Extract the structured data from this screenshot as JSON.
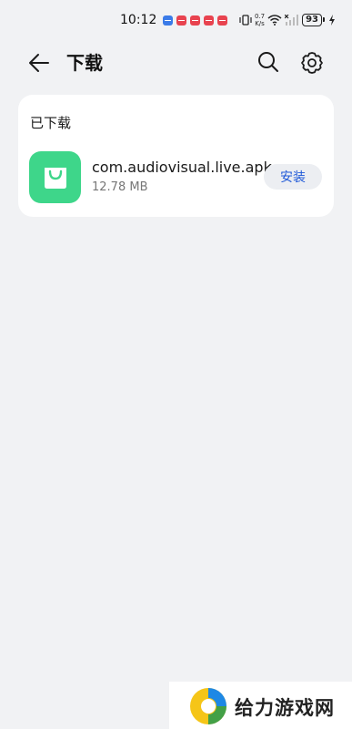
{
  "status_bar": {
    "time": "10:12",
    "network_speed_value": "0.7",
    "network_speed_unit": "K/s",
    "battery": "93",
    "notification_colors": [
      "#3b7be8",
      "#e8434f",
      "#e8434f",
      "#e8434f",
      "#e8434f"
    ]
  },
  "header": {
    "title": "下载"
  },
  "downloaded": {
    "section_title": "已下载",
    "items": [
      {
        "file_name": "com.audiovisual.live.apk",
        "size": "12.78 MB",
        "action_label": "安装",
        "icon": "shopping-bag-icon",
        "icon_color": "#3ed68a"
      }
    ]
  },
  "watermark": {
    "text": "给力游戏网"
  },
  "colors": {
    "background": "#f1f2f4",
    "card": "#ffffff",
    "accent": "#1f59d8"
  }
}
